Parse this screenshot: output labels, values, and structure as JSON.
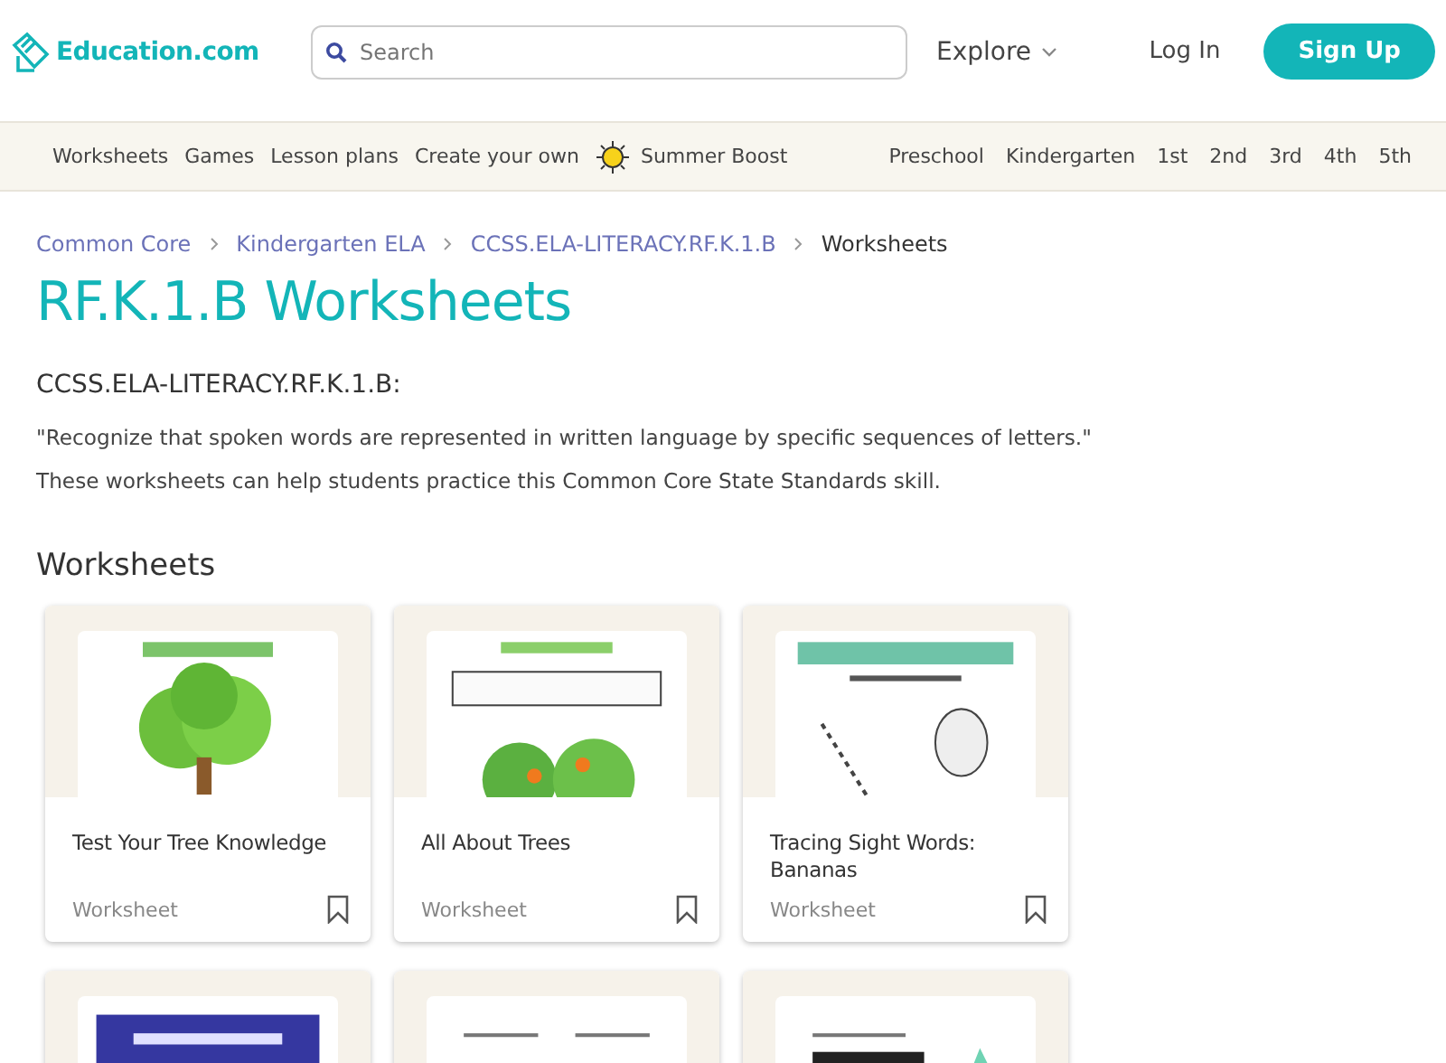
{
  "header": {
    "logo": "Education.com",
    "search": {
      "placeholder": "Search"
    },
    "explore": "Explore",
    "login": "Log In",
    "signup": "Sign Up"
  },
  "nav": {
    "left": [
      {
        "label": "Worksheets",
        "kind": "text"
      },
      {
        "label": "Games",
        "kind": "text"
      },
      {
        "label": "Lesson plans",
        "kind": "text"
      },
      {
        "label": "Create your own",
        "kind": "text"
      },
      {
        "label": "Summer Boost",
        "kind": "sun"
      }
    ],
    "grades": [
      "Preschool",
      "Kindergarten",
      "1st",
      "2nd",
      "3rd",
      "4th",
      "5th"
    ]
  },
  "breadcrumbs": [
    {
      "label": "Common Core",
      "link": true
    },
    {
      "label": "Kindergarten ELA",
      "link": true
    },
    {
      "label": "CCSS.ELA-LITERACY.RF.K.1.B",
      "link": true
    },
    {
      "label": "Worksheets",
      "link": false
    }
  ],
  "title": "RF.K.1.B Worksheets",
  "standard": {
    "code": "CCSS.ELA-LITERACY.RF.K.1.B:",
    "quote": "\"Recognize that spoken words are represented in written language by specific sequences of letters.\"",
    "note": "These worksheets can help students practice this Common Core State Standards skill."
  },
  "section_title": "Worksheets",
  "worksheets": [
    {
      "thumbnail": {
        "kind": "picture"
      },
      "title": "Test Your Tree Knowledge",
      "type": "Worksheet"
    },
    {
      "thumbnail": {
        "kind": "picture"
      },
      "title": "All About Trees",
      "type": "Worksheet"
    },
    {
      "thumbnail": {
        "kind": "picture"
      },
      "title": "Tracing Sight Words: Bananas",
      "type": "Worksheet"
    },
    {
      "thumbnail": {
        "kind": "picture"
      }
    },
    {
      "thumbnail": {
        "kind": "picture"
      }
    },
    {
      "thumbnail": {
        "kind": "picture"
      }
    }
  ]
}
